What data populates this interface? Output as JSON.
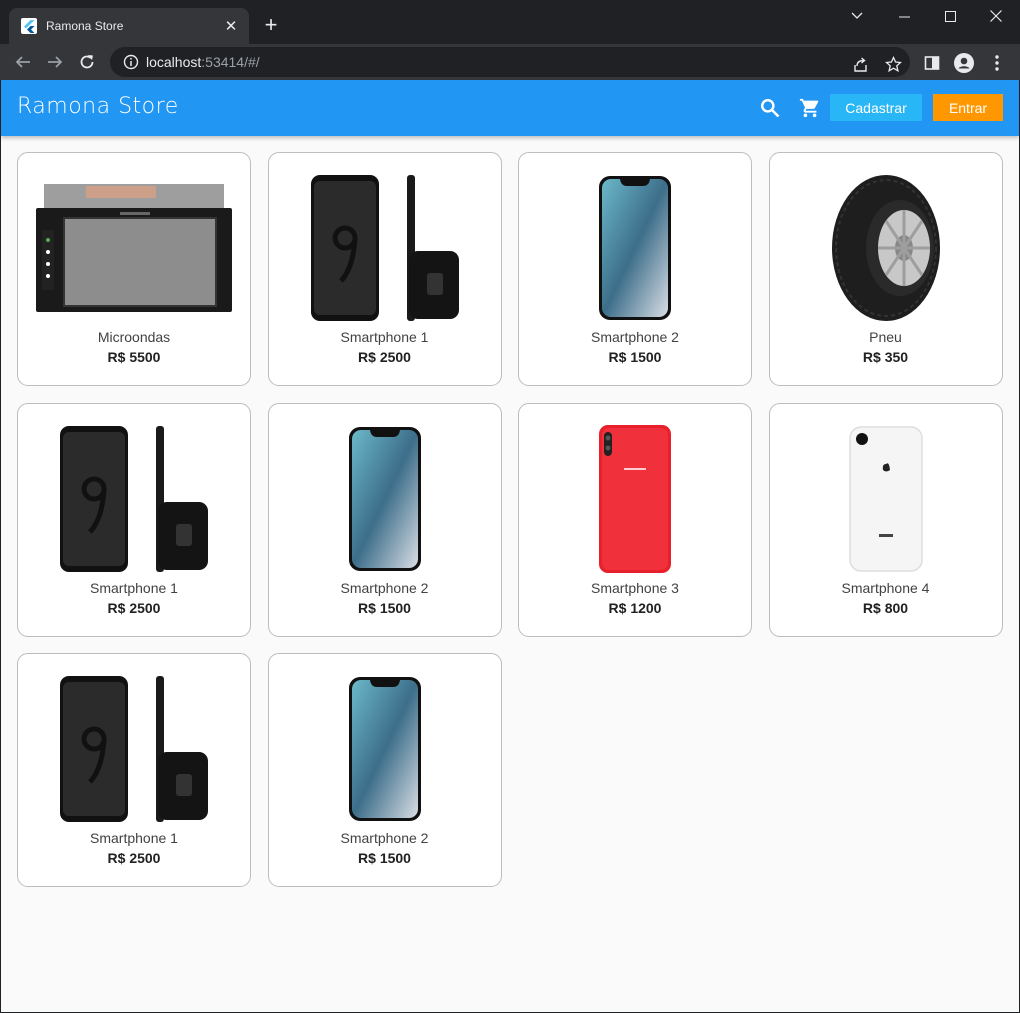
{
  "browser": {
    "tab_title": "Ramona Store",
    "url_host": "localhost",
    "url_rest": ":53414/#/",
    "colors": {
      "frame": "#202124",
      "toolbar": "#35363a"
    }
  },
  "app": {
    "brand": "Ramona Store",
    "register_label": "Cadastrar",
    "login_label": "Entrar",
    "colors": {
      "appbar": "#2196f3",
      "register": "#29b6f6",
      "login": "#ff9800"
    },
    "icons": [
      "search-icon",
      "cart-icon"
    ]
  },
  "products": [
    {
      "name": "Microondas",
      "price": "R$ 5500",
      "image": "car-stereo"
    },
    {
      "name": "Smartphone 1",
      "price": "R$ 2500",
      "image": "black-phone"
    },
    {
      "name": "Smartphone 2",
      "price": "R$ 1500",
      "image": "notch-phone"
    },
    {
      "name": "Pneu",
      "price": "R$ 350",
      "image": "tire"
    },
    {
      "name": "Smartphone 1",
      "price": "R$ 2500",
      "image": "black-phone"
    },
    {
      "name": "Smartphone 2",
      "price": "R$ 1500",
      "image": "notch-phone"
    },
    {
      "name": "Smartphone 3",
      "price": "R$ 1200",
      "image": "red-phone"
    },
    {
      "name": "Smartphone 4",
      "price": "R$ 800",
      "image": "white-phone"
    },
    {
      "name": "Smartphone 1",
      "price": "R$ 2500",
      "image": "black-phone"
    },
    {
      "name": "Smartphone 2",
      "price": "R$ 1500",
      "image": "notch-phone"
    }
  ]
}
